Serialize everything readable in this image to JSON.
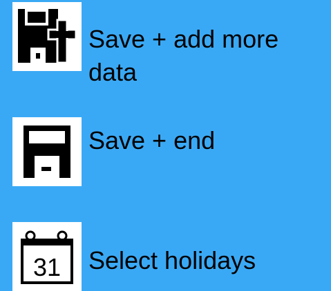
{
  "menu": {
    "items": [
      {
        "label": "Save + add more data",
        "icon": "save-add-icon"
      },
      {
        "label": "Save + end",
        "icon": "save-icon"
      },
      {
        "label": "Select holidays",
        "icon": "calendar-icon"
      }
    ],
    "calendar_day": "31"
  },
  "colors": {
    "background": "#3aa9f5",
    "icon_background": "#ffffff",
    "icon_foreground": "#000000",
    "text": "#000000"
  }
}
